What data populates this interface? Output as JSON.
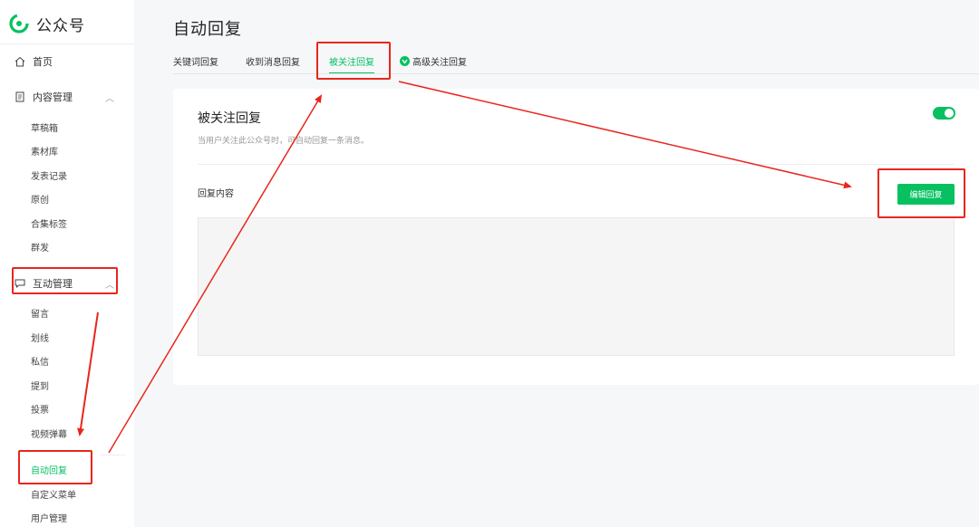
{
  "sidebar": {
    "logo_text": "公众号",
    "home": "首页",
    "content_mgmt": {
      "label": "内容管理",
      "items": [
        "草稿箱",
        "素材库",
        "发表记录",
        "原创",
        "合集标签",
        "群发"
      ]
    },
    "interaction_mgmt": {
      "label": "互动管理",
      "items": [
        "留言",
        "划线",
        "私信",
        "提到",
        "投票",
        "视频弹幕",
        "自动回复",
        "自定义菜单",
        "用户管理"
      ]
    }
  },
  "main": {
    "title": "自动回复",
    "tabs": [
      {
        "label": "关键词回复"
      },
      {
        "label": "收到消息回复"
      },
      {
        "label": "被关注回复"
      },
      {
        "label": "高级关注回复"
      }
    ],
    "card": {
      "title": "被关注回复",
      "description": "当用户关注此公众号时，可自动回复一条消息。",
      "reply_label": "回复内容",
      "edit_button": "编辑回复"
    }
  },
  "colors": {
    "accent": "#07c160",
    "annotation": "#e8261d"
  },
  "icons": {
    "home": "home-icon",
    "content": "document-icon",
    "interaction": "chat-bubble-icon",
    "advanced_badge": "check-badge-icon"
  }
}
